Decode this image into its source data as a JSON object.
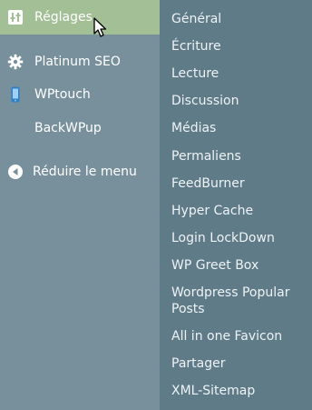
{
  "menu": {
    "active": {
      "label": "Réglages",
      "icon": "settings-sliders-icon"
    },
    "items": [
      {
        "label": "Platinum SEO",
        "icon": "gear-icon"
      },
      {
        "label": "WPtouch",
        "icon": "phone-icon"
      },
      {
        "label": "BackWPup",
        "icon": ""
      }
    ],
    "collapse": {
      "label": "Réduire le menu",
      "icon": "collapse-arrow-icon"
    }
  },
  "submenu": {
    "items": [
      "Général",
      "Écriture",
      "Lecture",
      "Discussion",
      "Médias",
      "Permaliens",
      "FeedBurner",
      "Hyper Cache",
      "Login LockDown",
      "WP Greet Box",
      "Wordpress Popular Posts",
      "All in one Favicon",
      "Partager",
      "XML-Sitemap"
    ]
  },
  "colors": {
    "menu_bg": "#78909c",
    "active_bg": "#a3bf95",
    "submenu_bg": "#5f7b88"
  }
}
